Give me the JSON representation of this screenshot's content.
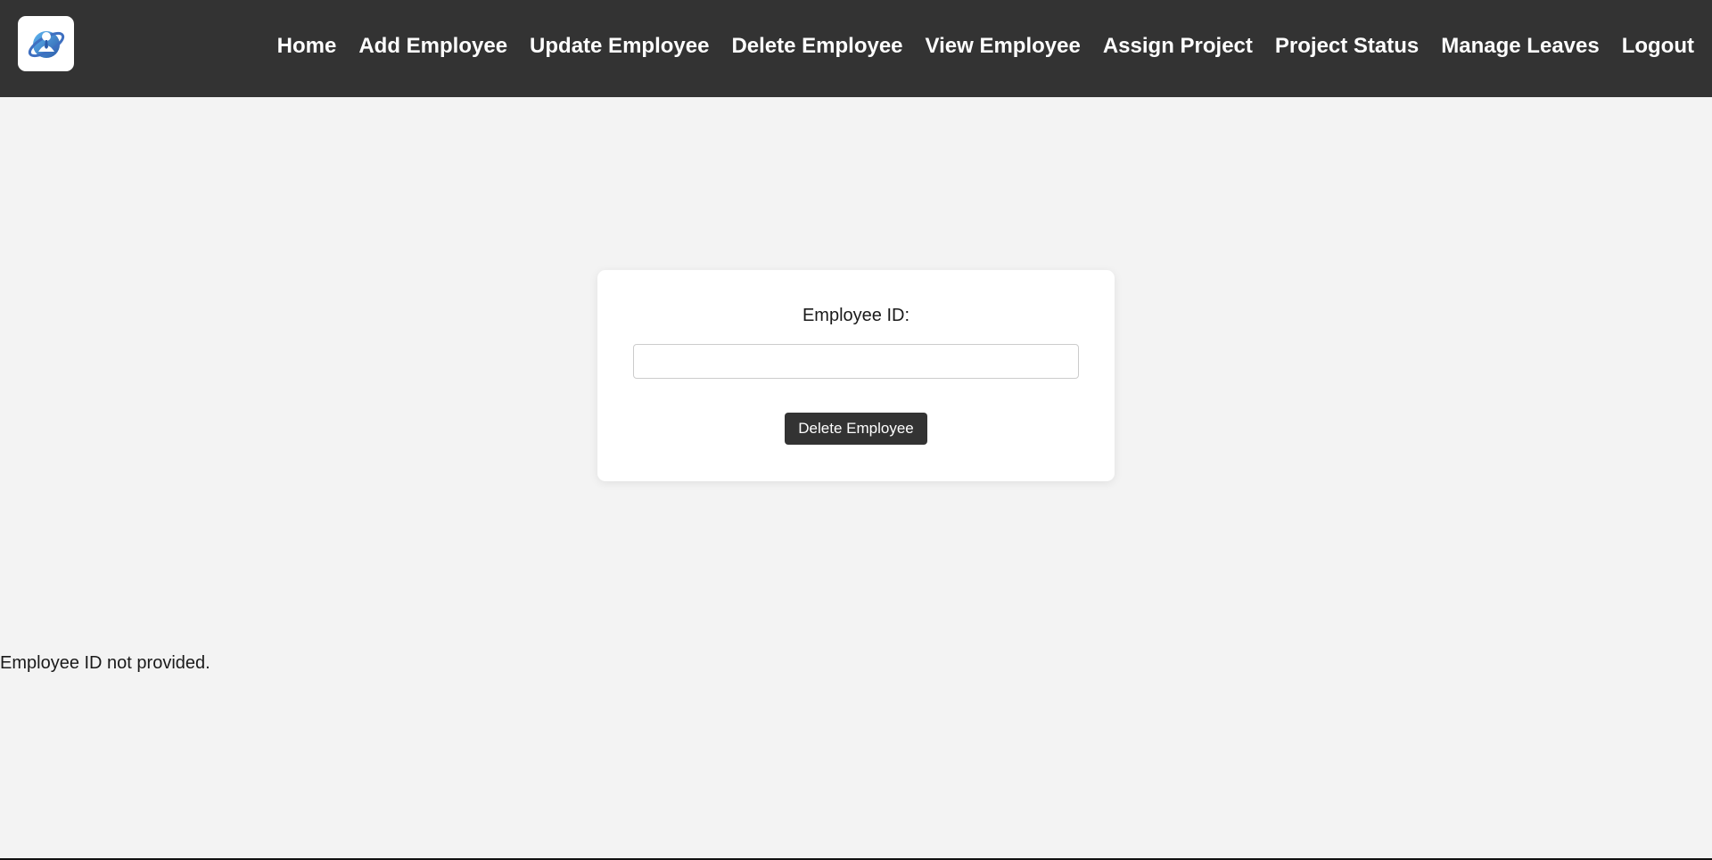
{
  "navbar": {
    "background": "#333333",
    "logo_icon": "employee-globe-logo-icon",
    "links": [
      {
        "label": "Home"
      },
      {
        "label": "Add Employee"
      },
      {
        "label": "Update Employee"
      },
      {
        "label": "Delete Employee"
      },
      {
        "label": "View Employee"
      },
      {
        "label": "Assign Project"
      },
      {
        "label": "Project Status"
      },
      {
        "label": "Manage Leaves"
      },
      {
        "label": "Logout"
      }
    ]
  },
  "form": {
    "employee_id_label": "Employee ID:",
    "employee_id_value": "",
    "submit_label": "Delete Employee"
  },
  "status": {
    "message": "Employee ID not provided."
  },
  "colors": {
    "page_background": "#f3f3f3",
    "card_background": "#ffffff",
    "button_background": "#333333"
  }
}
